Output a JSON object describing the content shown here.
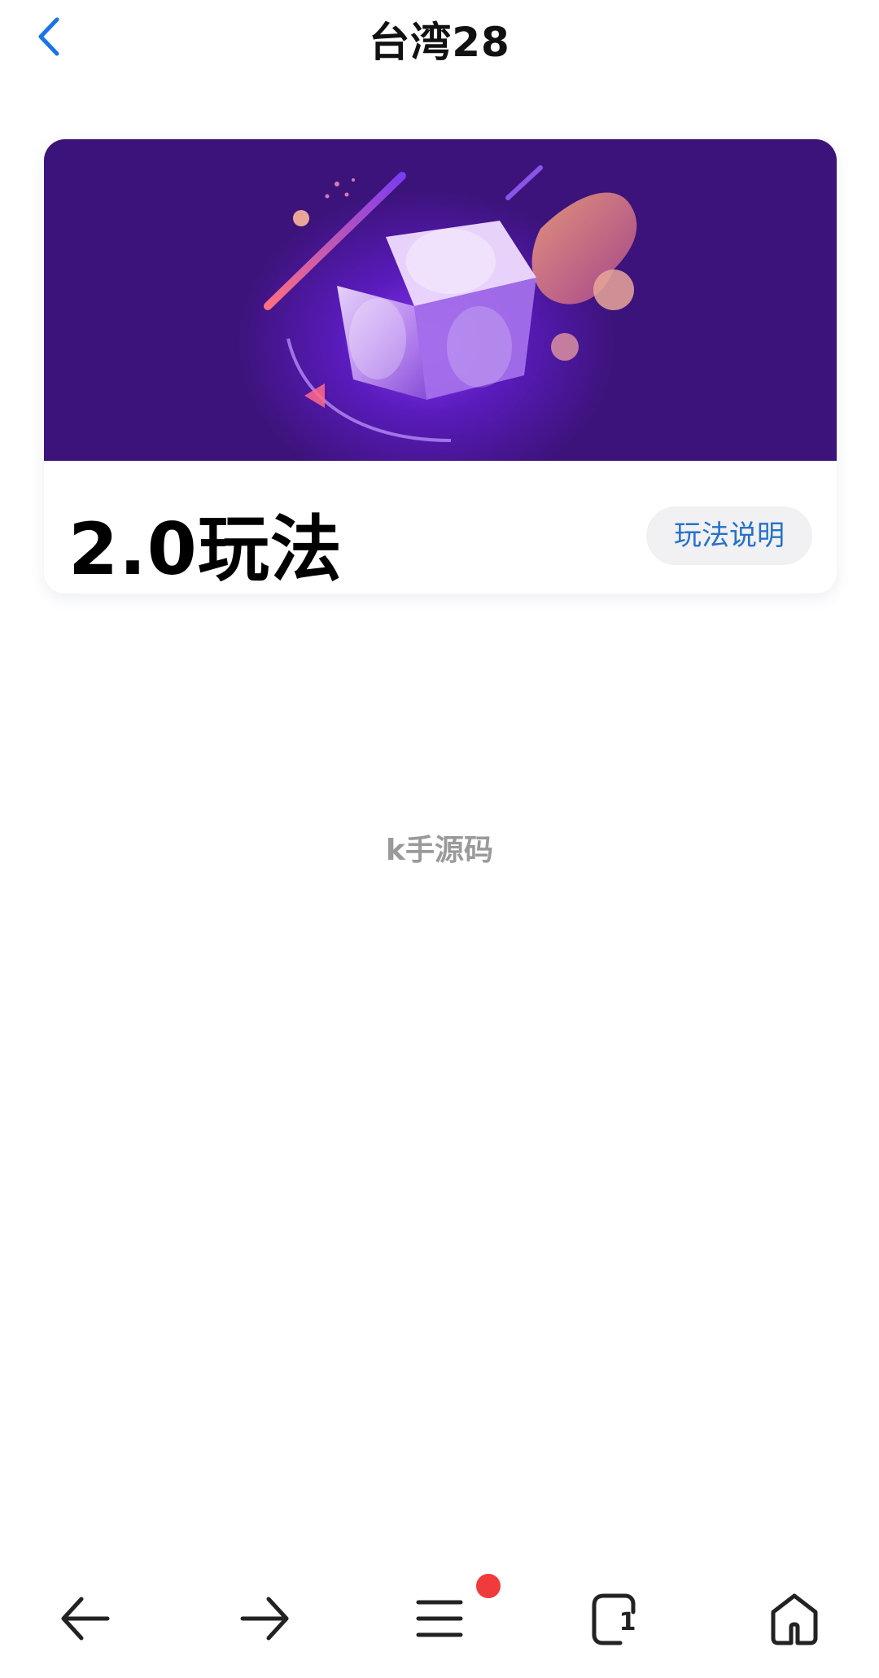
{
  "header": {
    "title": "台湾28",
    "back_icon": "chevron-left-icon"
  },
  "card": {
    "title": "2.0玩法",
    "rules_button": "玩法说明",
    "banner_colors": {
      "background": "#3c137a",
      "glow": "#7b2fe0",
      "accent": "#e98a6a"
    }
  },
  "watermark": "k手源码",
  "toolbar": {
    "items": [
      {
        "icon": "arrow-left-icon",
        "label": "back"
      },
      {
        "icon": "arrow-right-icon",
        "label": "forward"
      },
      {
        "icon": "menu-icon",
        "label": "menu",
        "has_badge": true,
        "badge_color": "#ef3b3b"
      },
      {
        "icon": "tabs-icon",
        "label": "tabs",
        "count": "1"
      },
      {
        "icon": "home-icon",
        "label": "home"
      }
    ]
  },
  "colors": {
    "accent": "#2672c8",
    "back_arrow": "#1a73e8"
  }
}
